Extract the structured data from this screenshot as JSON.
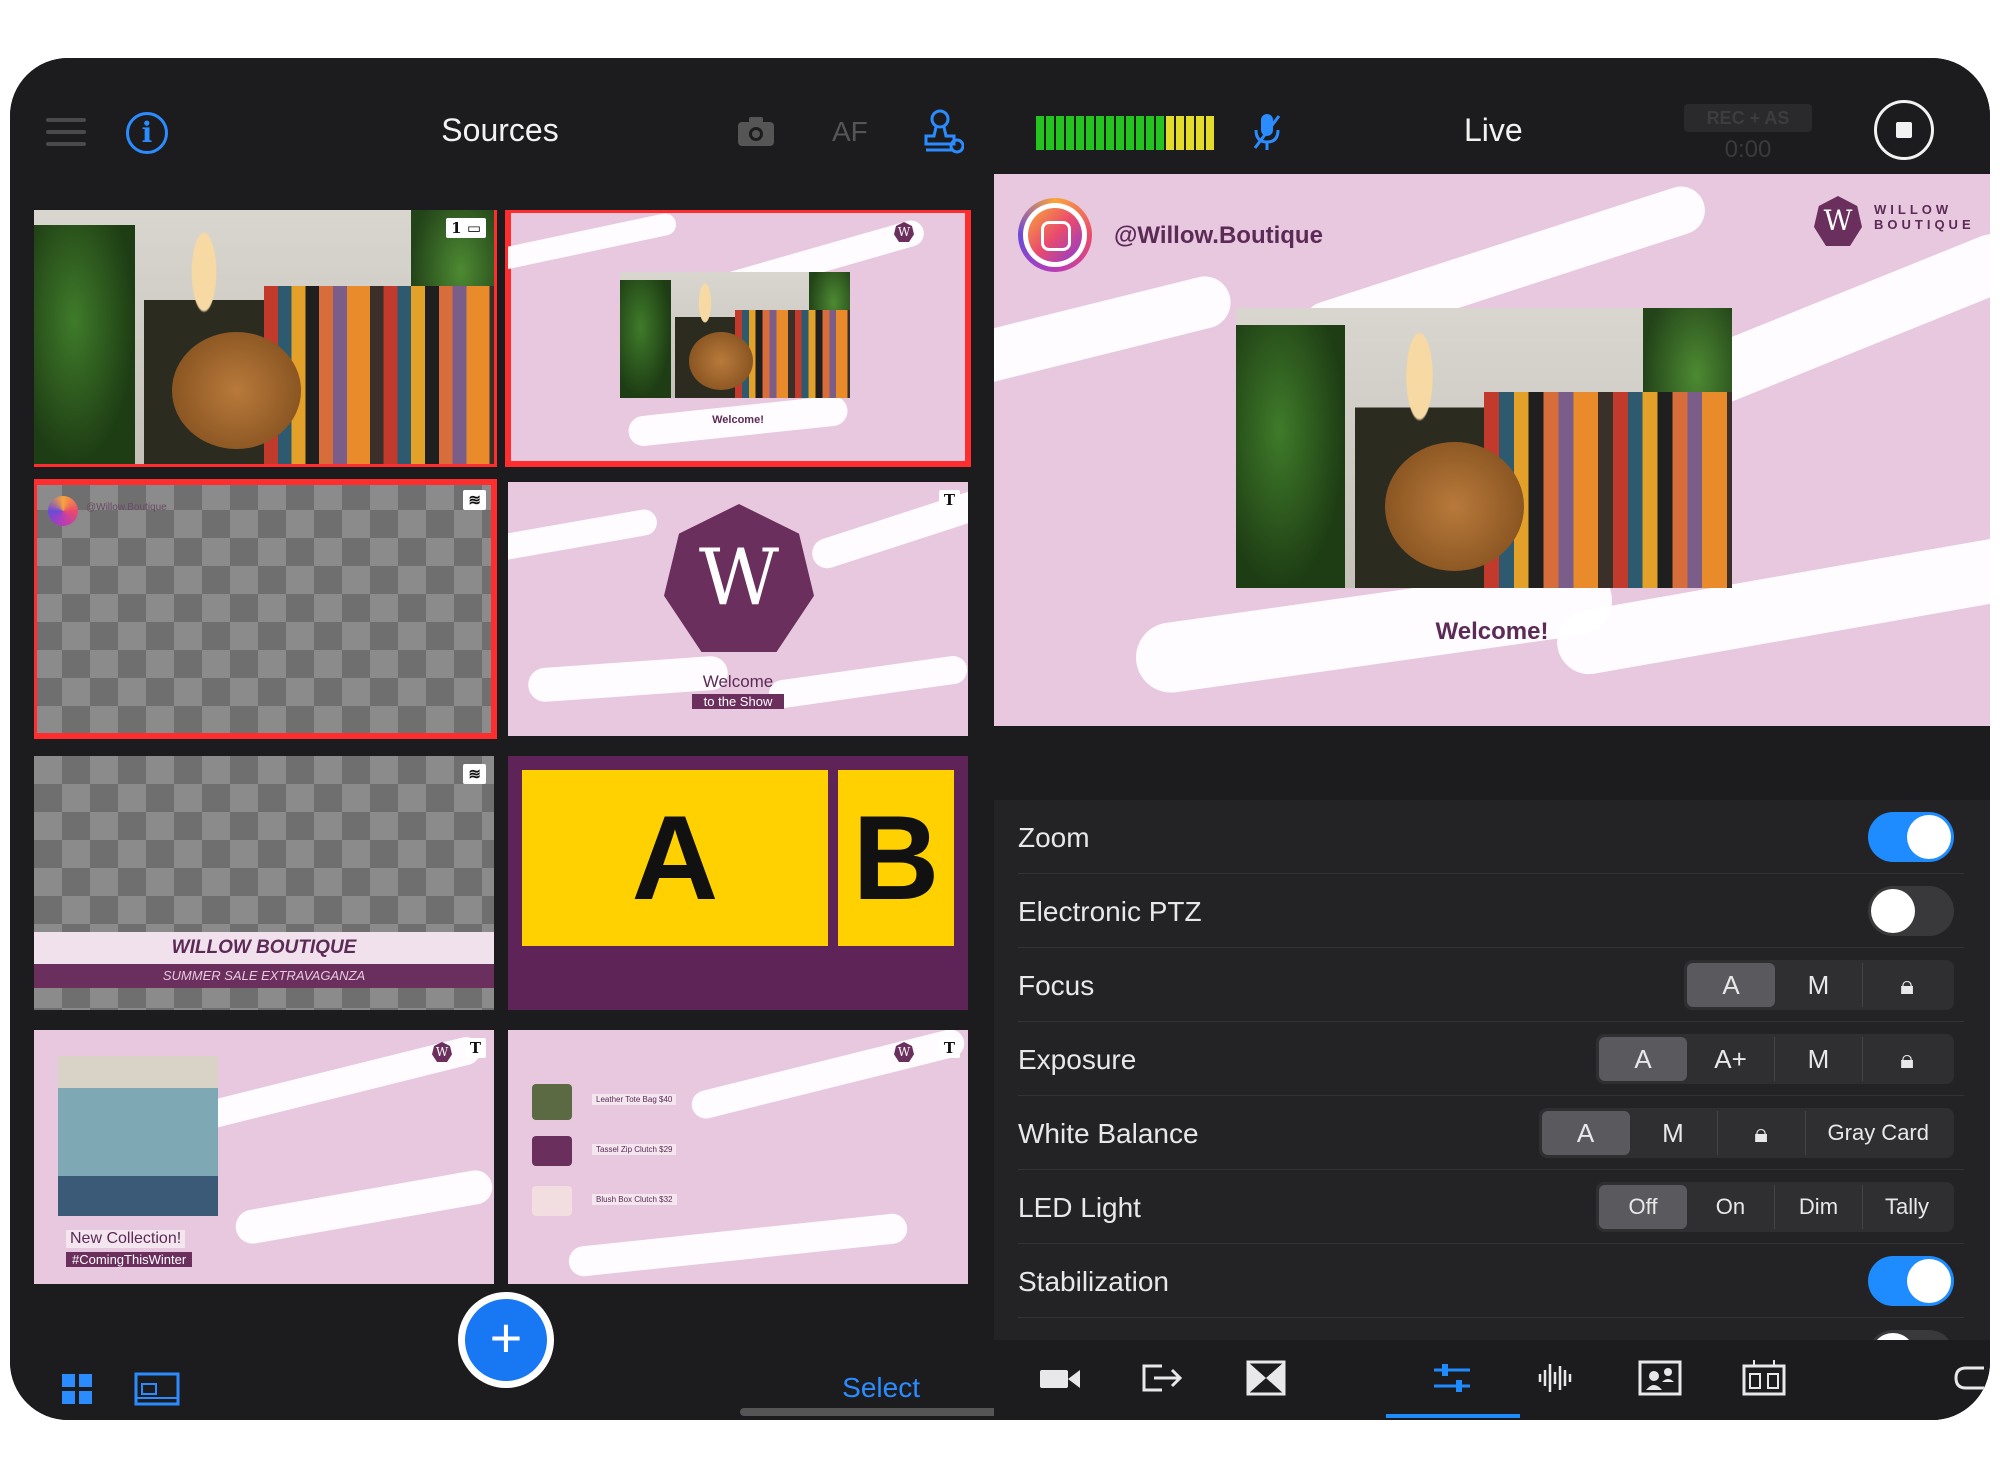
{
  "left_panel": {
    "title": "Sources",
    "af_label": "AF",
    "select_label": "Select",
    "add_label": "+",
    "tiles": {
      "t1": {
        "badge": "1"
      },
      "t2": {
        "caption": "Welcome!"
      },
      "t3": {
        "handle": "@Willow.Boutique"
      },
      "t4": {
        "logo_letter": "W",
        "title": "Welcome",
        "subtitle": "to the Show",
        "badge": "T"
      },
      "t5": {
        "title": "WILLOW BOUTIQUE",
        "subtitle": "SUMMER SALE EXTRAVAGANZA"
      },
      "t6": {
        "a": "A",
        "b": "B"
      },
      "t7": {
        "title": "New Collection!",
        "subtitle": "#ComingThisWinter",
        "badge": "T"
      },
      "t8": {
        "badge": "T",
        "items": [
          "Leather Tote Bag $40",
          "Tassel Zip Clutch $29",
          "Blush Box Clutch $32"
        ]
      }
    }
  },
  "right_panel": {
    "title": "Live",
    "rec_badge": "REC + AS",
    "rec_time": "0:00",
    "preview": {
      "handle": "@Willow.Boutique",
      "brand_letter": "W",
      "brand_name": "WILLOW BOUTIQUE",
      "caption": "Welcome!"
    },
    "settings": {
      "zoom": {
        "label": "Zoom",
        "on": true
      },
      "eptz": {
        "label": "Electronic PTZ",
        "on": false
      },
      "focus": {
        "label": "Focus",
        "options": [
          "A",
          "M"
        ],
        "selected": "A"
      },
      "exposure": {
        "label": "Exposure",
        "options": [
          "A",
          "A+",
          "M"
        ],
        "selected": "A"
      },
      "white_balance": {
        "label": "White Balance",
        "options": [
          "A",
          "M",
          "Gray Card"
        ],
        "selected": "A"
      },
      "led": {
        "label": "LED Light",
        "options": [
          "Off",
          "On",
          "Dim",
          "Tally"
        ],
        "selected": "Off"
      },
      "stabilization": {
        "label": "Stabilization",
        "on": true
      }
    }
  },
  "colors": {
    "accent": "#1e8bff",
    "selection": "#ff2d2d",
    "brand": "#6b2f5e",
    "pink": "#e7c8df",
    "yellow": "#ffd100"
  }
}
